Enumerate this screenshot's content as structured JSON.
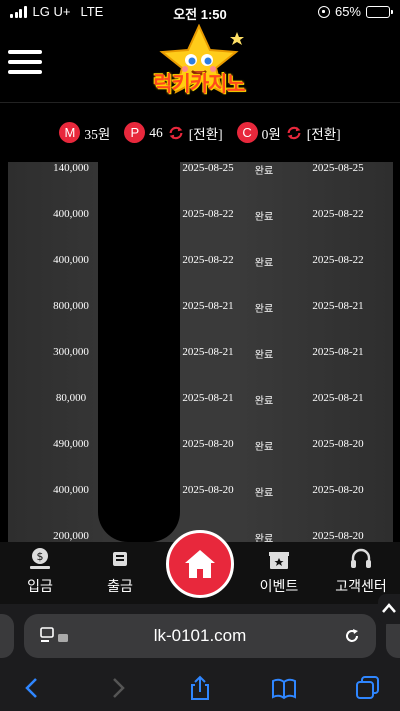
{
  "status_bar": {
    "carrier": "LG U+",
    "network": "LTE",
    "time": "오전 1:50",
    "battery": "65%",
    "battery_level": 0.65
  },
  "header": {
    "logo_text": "럭키카지노"
  },
  "balance": {
    "m_label": "M",
    "m_value": "35원",
    "p_label": "P",
    "p_value": "46",
    "convert_1": "[전환]",
    "c_label": "C",
    "c_value": "0원",
    "convert_2": "[전환]"
  },
  "rows": [
    {
      "amount": "140,000",
      "date1": "2025-08-25",
      "status": "완료",
      "date2": "2025-08-25"
    },
    {
      "amount": "400,000",
      "date1": "2025-08-22",
      "status": "완료",
      "date2": "2025-08-22"
    },
    {
      "amount": "400,000",
      "date1": "2025-08-22",
      "status": "완료",
      "date2": "2025-08-22"
    },
    {
      "amount": "800,000",
      "date1": "2025-08-21",
      "status": "완료",
      "date2": "2025-08-21"
    },
    {
      "amount": "300,000",
      "date1": "2025-08-21",
      "status": "완료",
      "date2": "2025-08-21"
    },
    {
      "amount": "80,000",
      "date1": "2025-08-21",
      "status": "완료",
      "date2": "2025-08-21"
    },
    {
      "amount": "490,000",
      "date1": "2025-08-20",
      "status": "완료",
      "date2": "2025-08-20"
    },
    {
      "amount": "400,000",
      "date1": "2025-08-20",
      "status": "완료",
      "date2": "2025-08-20"
    },
    {
      "amount": "200,000",
      "date1": "",
      "status": "완료",
      "date2": "2025-08-20"
    }
  ],
  "nav": {
    "deposit": "입금",
    "withdraw": "출금",
    "event": "이벤트",
    "support": "고객센터"
  },
  "browser": {
    "url": "lk-0101.com"
  },
  "colors": {
    "accent": "#e8283c",
    "panel": "#3a3a3a"
  }
}
